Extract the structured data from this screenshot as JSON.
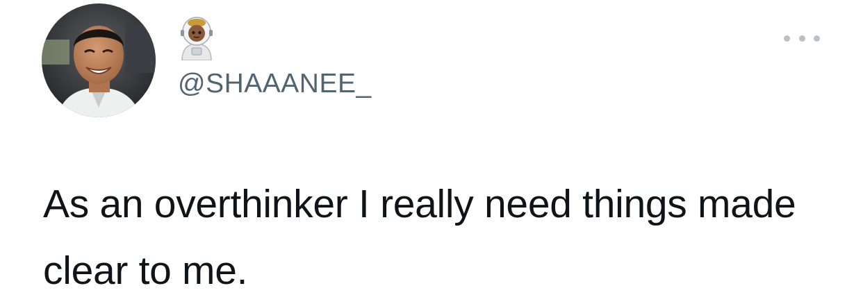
{
  "tweet": {
    "author": {
      "handle": "@SHAAANEE_",
      "avatar_icon": "profile-photo",
      "name_emoji": "astronaut-emoji"
    },
    "more_icon": "more-options-icon",
    "text": "As an overthinker I really need things made clear to me."
  },
  "colors": {
    "background": "#ffffff",
    "text": "#0f1419",
    "handle": "#536471",
    "more_dots": "#b9c1c8"
  }
}
